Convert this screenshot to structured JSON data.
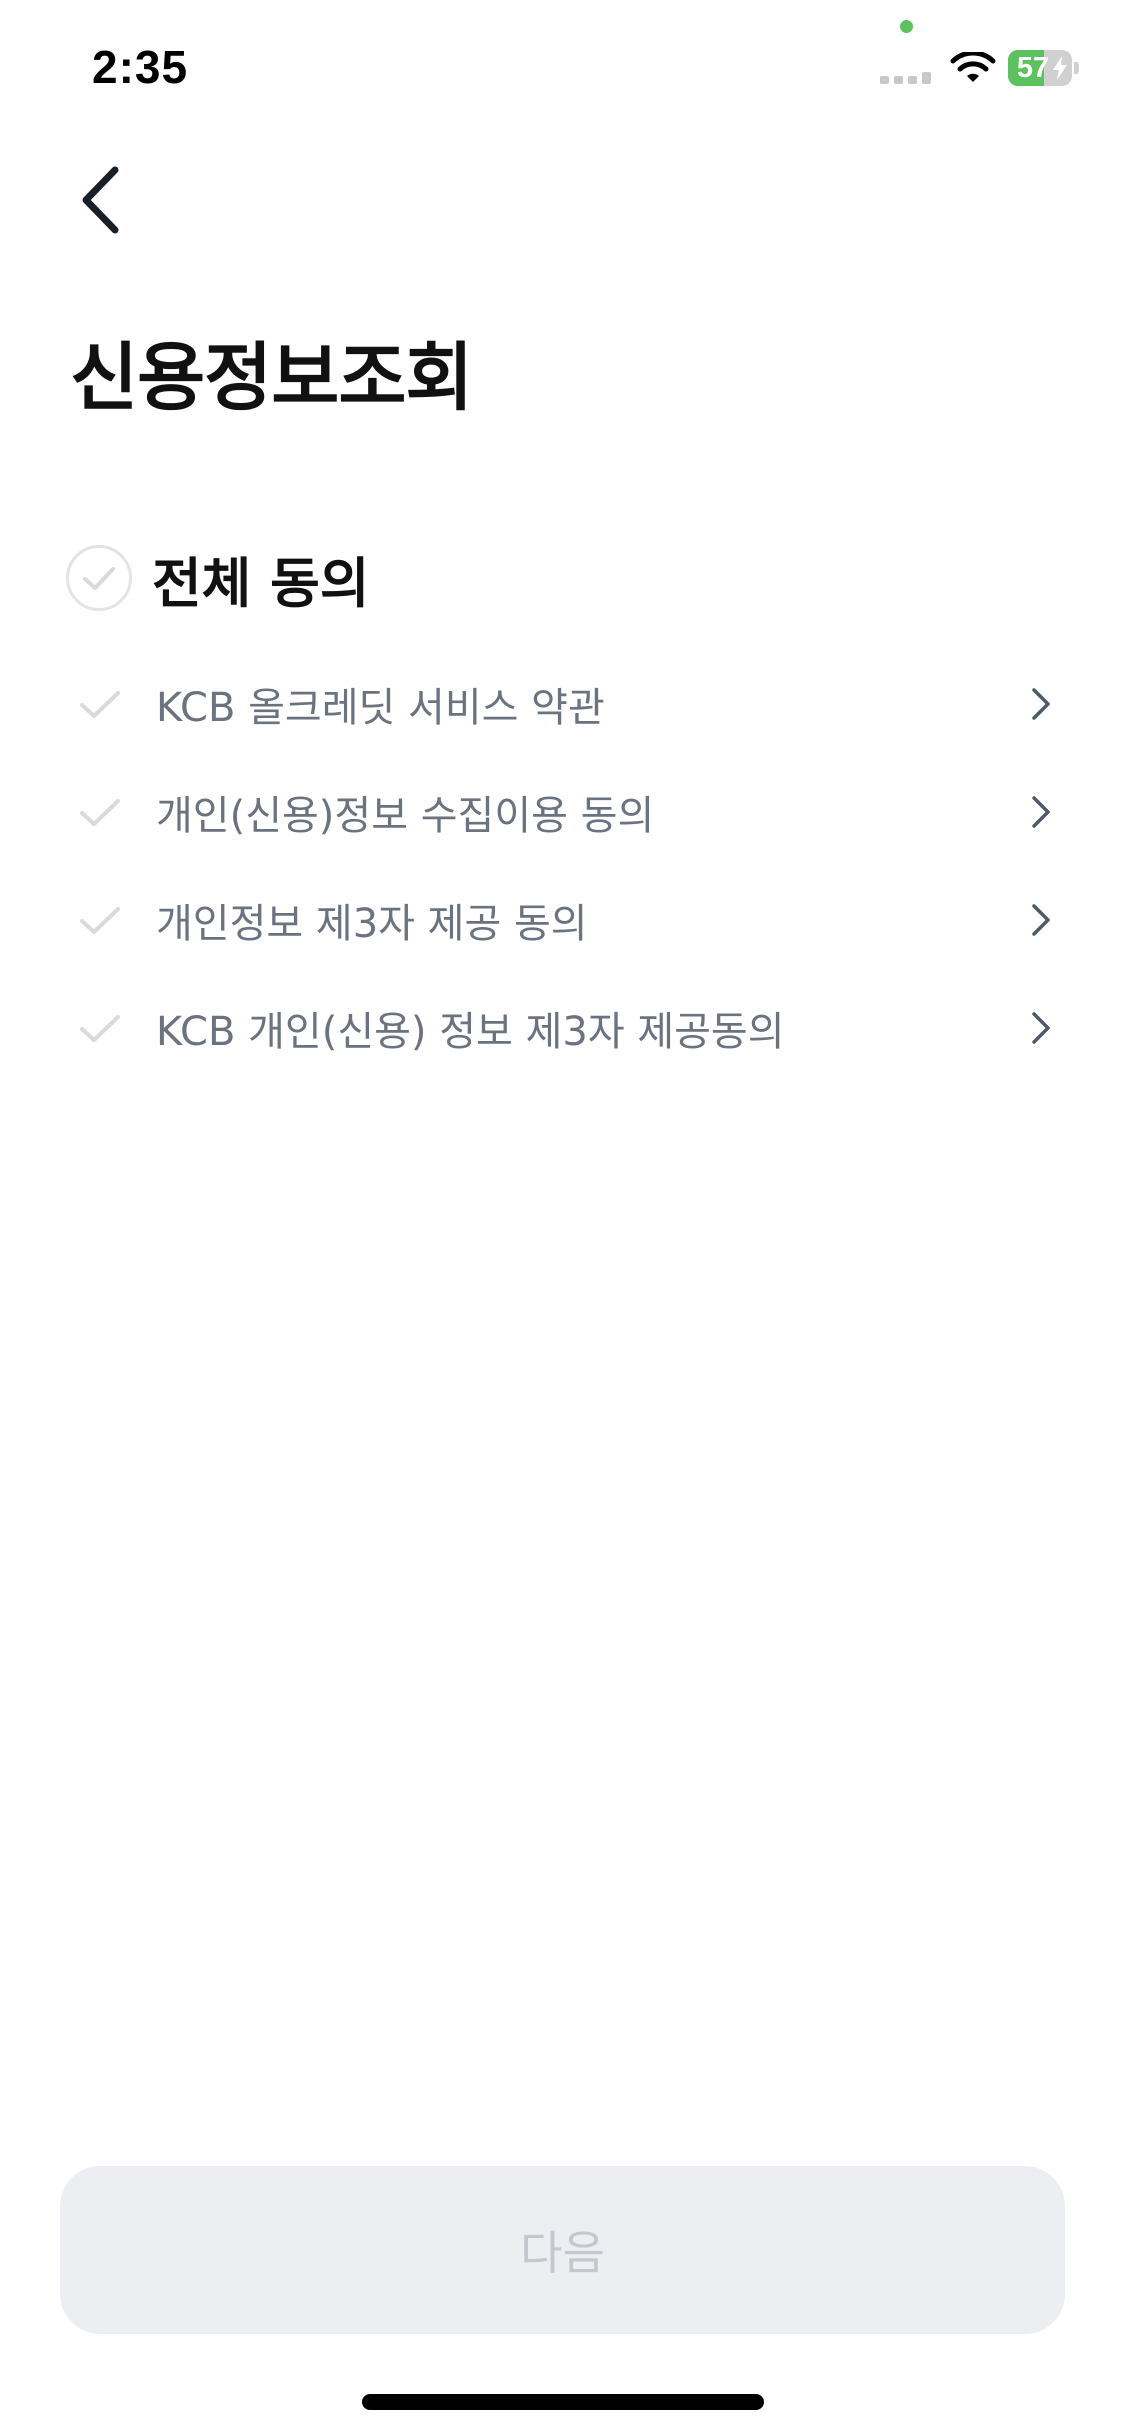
{
  "status_bar": {
    "time": "2:35",
    "battery_level": "57",
    "battery_fraction": 0.57,
    "battery_charging": true,
    "signal_icon": "cellular-signal-icon",
    "wifi_icon": "wifi-icon",
    "privacy_indicator_color": "#5ac35e"
  },
  "header": {
    "back_icon": "chevron-left-icon",
    "title": "신용정보조회"
  },
  "agree_all": {
    "label": "전체 동의",
    "checked": false,
    "icon": "check-circle-icon"
  },
  "terms": [
    {
      "label": "KCB 올크레딧 서비스 약관",
      "checked": false
    },
    {
      "label": "개인(신용)정보 수집이용 동의",
      "checked": false
    },
    {
      "label": "개인정보 제3자 제공 동의",
      "checked": false
    },
    {
      "label": "KCB 개인(신용) 정보 제3자 제공동의",
      "checked": false
    }
  ],
  "next_button": {
    "label": "다음",
    "enabled": false
  },
  "colors": {
    "background": "#ffffff",
    "title_text": "#111111",
    "term_text": "#6b7280",
    "check_inactive": "#d8dade",
    "button_disabled_bg": "#eceef2",
    "button_disabled_text": "#c4c8ce",
    "battery_green": "#5ac35e"
  }
}
